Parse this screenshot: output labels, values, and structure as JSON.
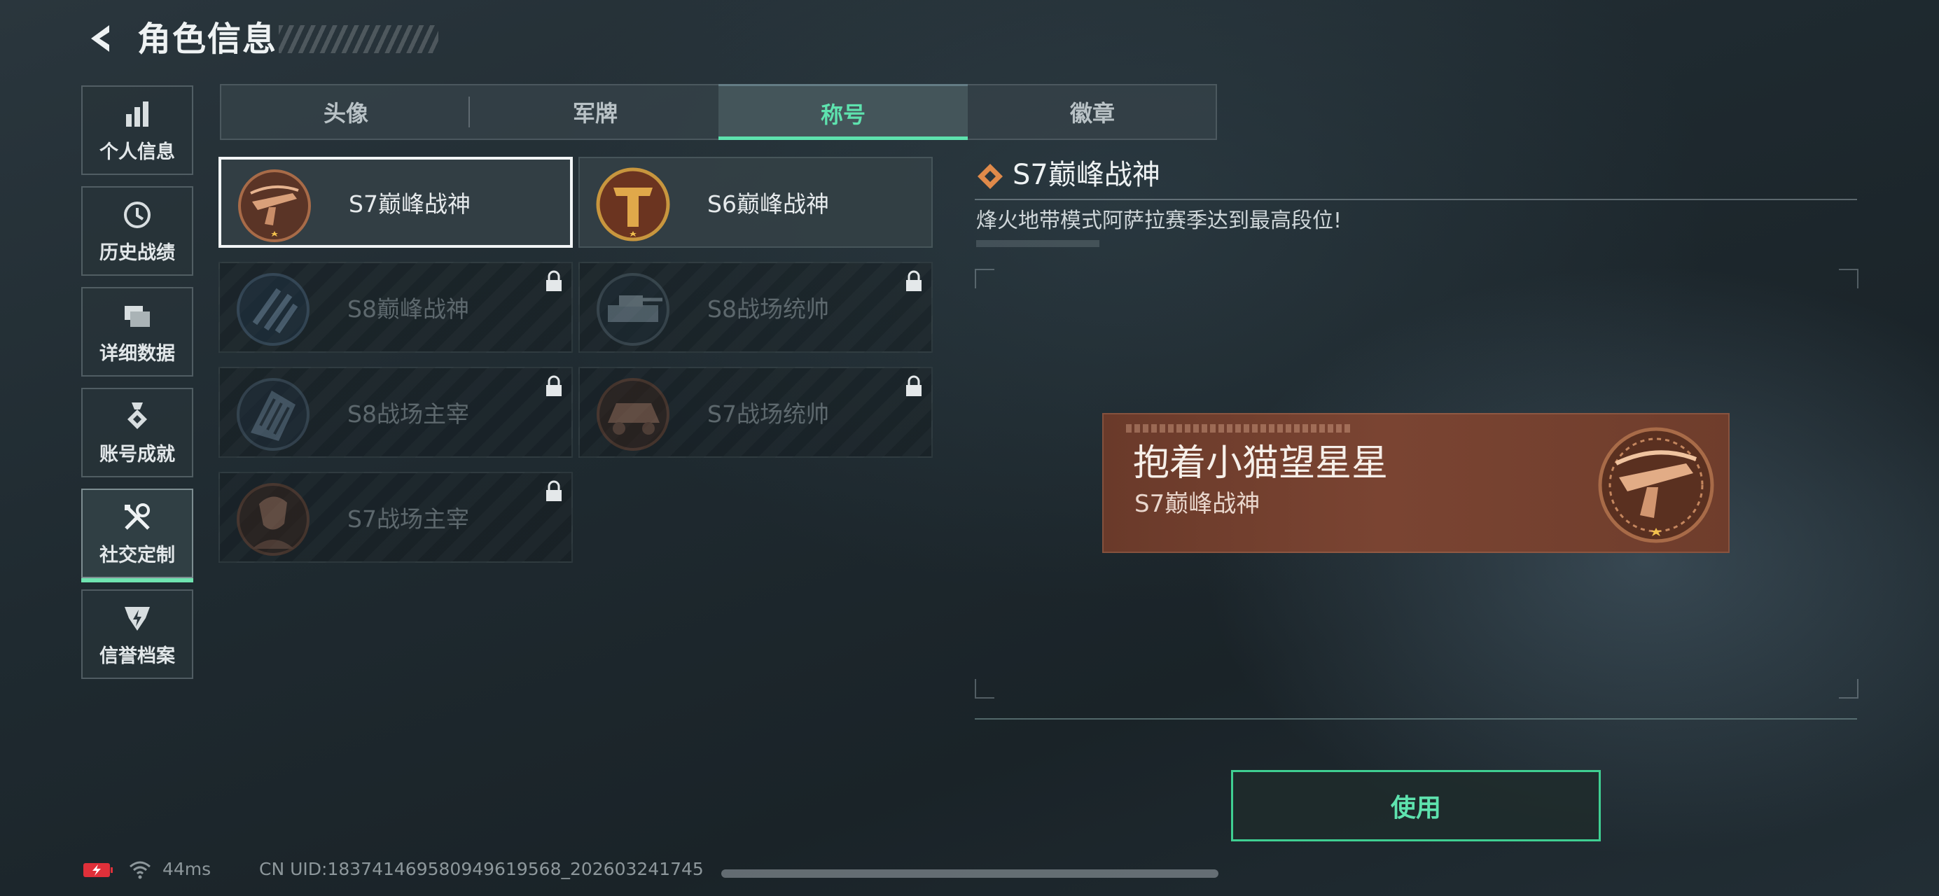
{
  "header": {
    "title": "角色信息",
    "back_icon": "back-arrow-icon"
  },
  "sidebar": {
    "items": [
      {
        "label": "个人信息",
        "icon": "bar-chart-icon",
        "active": false
      },
      {
        "label": "历史战绩",
        "icon": "history-clock-icon",
        "active": false
      },
      {
        "label": "详细数据",
        "icon": "folders-icon",
        "active": false
      },
      {
        "label": "账号成就",
        "icon": "medal-icon",
        "active": false
      },
      {
        "label": "社交定制",
        "icon": "tools-icon",
        "active": true
      },
      {
        "label": "信誉档案",
        "icon": "shield-badge-icon",
        "active": false
      }
    ],
    "accent": "#6fe3b0"
  },
  "tabs": [
    {
      "label": "头像",
      "active": false
    },
    {
      "label": "军牌",
      "active": false
    },
    {
      "label": "称号",
      "active": true
    },
    {
      "label": "徽章",
      "active": false
    }
  ],
  "titles": [
    {
      "name": "S7巅峰战神",
      "locked": false,
      "selected": true,
      "emblem": "crossbow-emblem-icon"
    },
    {
      "name": "S6巅峰战神",
      "locked": false,
      "selected": false,
      "emblem": "gold-t-emblem-icon"
    },
    {
      "name": "S8巅峰战神",
      "locked": true,
      "selected": false,
      "emblem": "claw-emblem-icon"
    },
    {
      "name": "S8战场统帅",
      "locked": true,
      "selected": false,
      "emblem": "tank-emblem-icon"
    },
    {
      "name": "S8战场主宰",
      "locked": true,
      "selected": false,
      "emblem": "building-emblem-icon"
    },
    {
      "name": "S7战场统帅",
      "locked": true,
      "selected": false,
      "emblem": "armored-car-emblem-icon"
    },
    {
      "name": "S7战场主宰",
      "locked": true,
      "selected": false,
      "emblem": "soldier-emblem-icon"
    }
  ],
  "detail": {
    "title": "S7巅峰战神",
    "description": "烽火地带模式阿萨拉赛季达到最高段位!",
    "icon": "diamond-icon"
  },
  "preview": {
    "player_name": "抱着小猫望星星",
    "title": "S7巅峰战神",
    "emblem": "crossbow-emblem-icon"
  },
  "actions": {
    "use_label": "使用",
    "accent": "#5ee2ae"
  },
  "status": {
    "ping": "44ms",
    "uid": "CN UID:18374146958094961956​8_202603241745",
    "battery_icon": "battery-low-icon",
    "wifi_icon": "wifi-icon"
  }
}
